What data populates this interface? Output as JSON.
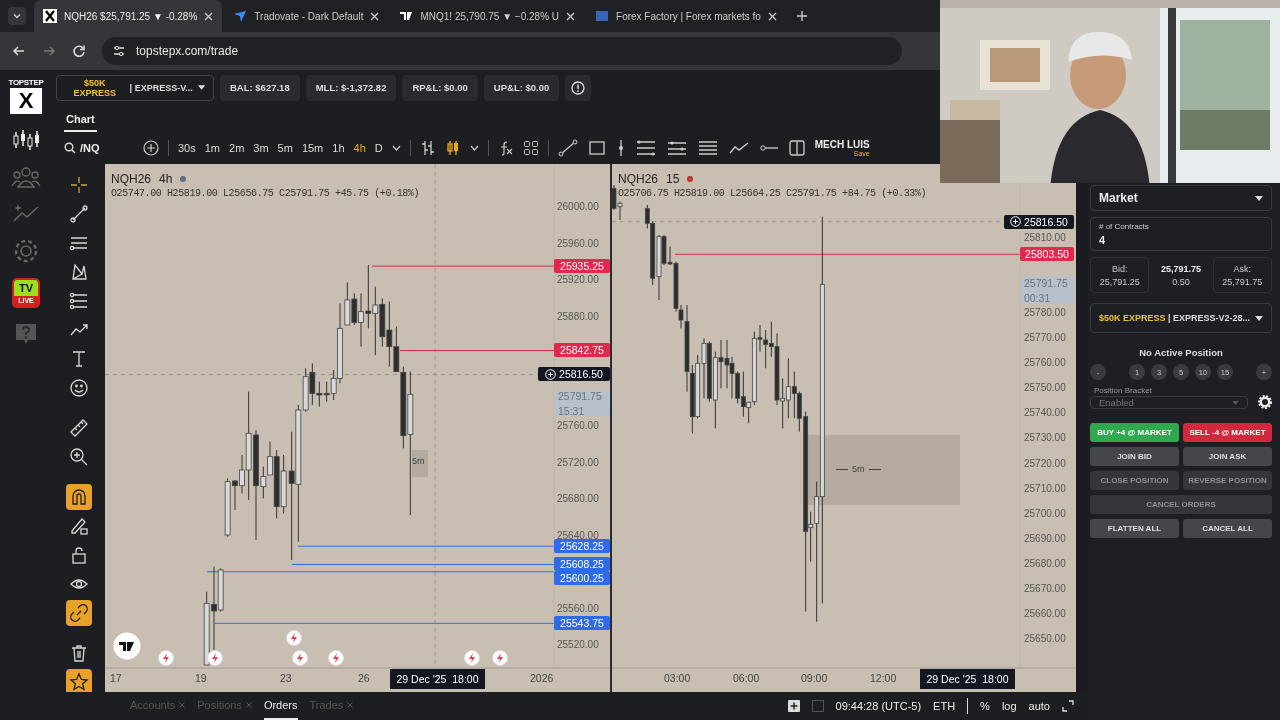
{
  "browser": {
    "tabs": [
      {
        "title": "NQH26 $25,791.25 ▼ -0.28%",
        "selected": true
      },
      {
        "title": "Tradovate - Dark Default",
        "selected": false
      },
      {
        "title": "MNQ1! 25,790.75 ▼ −0.28% U",
        "selected": false
      },
      {
        "title": "Forex Factory | Forex markets fo",
        "selected": false
      }
    ],
    "url": "topstepx.com/trade"
  },
  "logo": {
    "top": "TOPSTEP",
    "letter": "X"
  },
  "live_badge": {
    "top": "TV",
    "bottom": "LIVE"
  },
  "account_bar": {
    "account_name": "$50K EXPRESS",
    "account_id": "| EXPRESS-V...",
    "stats": [
      "BAL: $627.18",
      "MLL: $-1,372.82",
      "RP&L: $0.00",
      "UP&L: $0.00"
    ]
  },
  "chart_tabs": [
    {
      "label": "Chart",
      "selected": true
    }
  ],
  "toolbar": {
    "symbol": "/NQ",
    "intervals": [
      {
        "label": "30s",
        "selected": false
      },
      {
        "label": "1m",
        "selected": false
      },
      {
        "label": "2m",
        "selected": false
      },
      {
        "label": "3m",
        "selected": false
      },
      {
        "label": "5m",
        "selected": false
      },
      {
        "label": "15m",
        "selected": false
      },
      {
        "label": "1h",
        "selected": false
      },
      {
        "label": "4h",
        "selected": true
      },
      {
        "label": "D",
        "selected": false
      }
    ],
    "layout_name": "MECH LUIS",
    "save_label": "Save"
  },
  "drawing_tools": [
    {
      "kind": "crosshair",
      "active": false
    },
    {
      "kind": "line",
      "active": false
    },
    {
      "kind": "channel",
      "active": false
    },
    {
      "kind": "pattern",
      "active": false
    },
    {
      "kind": "fib",
      "active": false
    },
    {
      "kind": "path",
      "active": false
    },
    {
      "kind": "text",
      "active": false
    },
    {
      "kind": "emoji",
      "active": false
    },
    {
      "kind": "ruler",
      "active": false
    },
    {
      "kind": "zoom",
      "active": false
    },
    {
      "kind": "magnet",
      "active": true
    },
    {
      "kind": "pencil",
      "active": false
    },
    {
      "kind": "lock",
      "active": false
    },
    {
      "kind": "eye",
      "active": false
    },
    {
      "kind": "link",
      "active": true
    },
    {
      "kind": "trash",
      "active": false
    },
    {
      "kind": "star",
      "active": true
    }
  ],
  "charts": [
    {
      "symbol": "NQH26",
      "interval": "4h",
      "live": false,
      "ohlc": "O25747.00 H25819.00 L25656.75 C25791.75 +45.75 (+0.18%)",
      "price_labels": [
        "26000.00",
        "25960.00",
        "25920.00",
        "25880.00",
        "25760.00",
        "25720.00",
        "25680.00",
        "25640.00",
        "25560.00",
        "25520.00"
      ],
      "tags": [
        {
          "value": "25935.25",
          "kind": "sell"
        },
        {
          "value": "25842.75",
          "kind": "sell"
        },
        {
          "value": "25816.50",
          "kind": "cursor"
        },
        {
          "value": "25791.75",
          "sub": "15:31",
          "kind": "last"
        },
        {
          "value": "25628.25",
          "kind": "buy"
        },
        {
          "value": "25608.25",
          "kind": "buy"
        },
        {
          "value": "25600.25",
          "kind": "buy"
        },
        {
          "value": "25543.75",
          "kind": "buy"
        }
      ],
      "time_labels": [
        "17",
        "19",
        "23",
        "26",
        "2026"
      ],
      "crosshair_time": "29 Dec '25  18:00",
      "zone_label": "5m"
    },
    {
      "symbol": "NQH26",
      "interval": "15",
      "live": true,
      "ohlc": "O25706.75 H25819.00 L25664.25 C25791.75 +84.75 (+0.33%)",
      "price_labels": [
        "25810.00",
        "25780.00",
        "25770.00",
        "25760.00",
        "25750.00",
        "25740.00",
        "25730.00",
        "25720.00",
        "25710.00",
        "25700.00",
        "25690.00",
        "25680.00",
        "25670.00",
        "25660.00",
        "25650.00"
      ],
      "tags": [
        {
          "value": "25816.50",
          "kind": "cursor"
        },
        {
          "value": "25803.50",
          "kind": "sell"
        },
        {
          "value": "25791.75",
          "sub": "00:31",
          "kind": "last"
        }
      ],
      "time_labels": [
        "03:00",
        "06:00",
        "09:00",
        "12:00"
      ],
      "crosshair_time": "29 Dec '25  18:00",
      "zone_label": "5m"
    }
  ],
  "order_panel": {
    "order_type": "Market",
    "contracts_label": "# of Contracts",
    "contracts": "4",
    "bid_label": "Bid:",
    "bid": "25,791.25",
    "last": "25,791.75",
    "spread": "0.50",
    "ask_label": "Ask:",
    "ask": "25,791.75",
    "account_name": "$50K EXPRESS",
    "account_id": "| EXPRESS-V2-28...",
    "position_status": "No Active Position",
    "quantity_buttons": [
      "-",
      "1",
      "3",
      "5",
      "10",
      "15",
      "+"
    ],
    "bracket_label": "Position Bracket",
    "bracket": "Enabled",
    "actions": [
      {
        "label": "BUY +4 @ MARKET",
        "kind": "buy",
        "disabled": false
      },
      {
        "label": "SELL -4 @ MARKET",
        "kind": "sell",
        "disabled": false
      },
      {
        "label": "JOIN BID",
        "kind": "half",
        "disabled": false
      },
      {
        "label": "JOIN ASK",
        "kind": "half",
        "disabled": false
      },
      {
        "label": "CLOSE POSITION",
        "kind": "half",
        "disabled": true
      },
      {
        "label": "REVERSE POSITION",
        "kind": "half",
        "disabled": true
      },
      {
        "label": "CANCEL ORDERS",
        "kind": "wide",
        "disabled": true
      },
      {
        "label": "FLATTEN ALL",
        "kind": "half",
        "disabled": false
      },
      {
        "label": "CANCEL ALL",
        "kind": "half",
        "disabled": false
      }
    ]
  },
  "bottom_bar": {
    "tabs": [
      {
        "label": "Accounts",
        "selected": false
      },
      {
        "label": "Positions",
        "selected": false
      },
      {
        "label": "Orders",
        "selected": true
      },
      {
        "label": "Trades",
        "selected": false
      }
    ],
    "time": "09:44:28 (UTC-5)",
    "session": "ETH",
    "scale_buttons": [
      "%",
      "log",
      "auto"
    ]
  }
}
